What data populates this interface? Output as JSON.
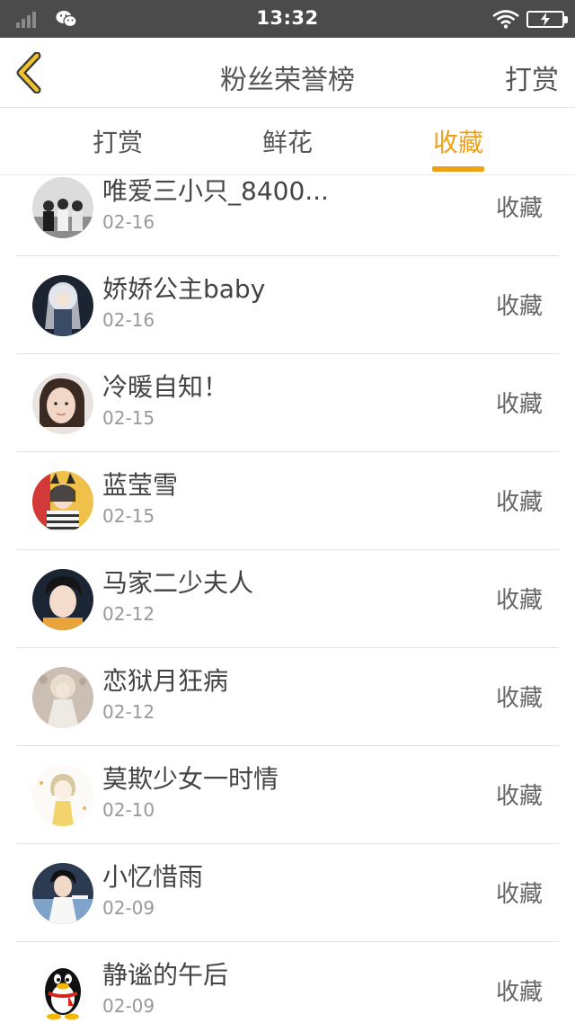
{
  "status_bar": {
    "time": "13:32"
  },
  "header": {
    "title": "粉丝荣誉榜",
    "reward_label": "打赏"
  },
  "tabs": [
    {
      "label": "打赏"
    },
    {
      "label": "鲜花"
    },
    {
      "label": "收藏"
    }
  ],
  "active_tab": "收藏",
  "colors": {
    "accent": "#eea117",
    "status_bar": "#4b4b4b"
  },
  "list": [
    {
      "name": "唯爱三小只_8400...",
      "date": "02-16",
      "action": "收藏",
      "avatar": "group-photo-avatar"
    },
    {
      "name": "娇娇公主baby",
      "date": "02-16",
      "action": "收藏",
      "avatar": "anime-girl-avatar"
    },
    {
      "name": "冷暖自知！",
      "date": "02-15",
      "action": "收藏",
      "avatar": "girl-photo-avatar"
    },
    {
      "name": "蓝莹雪",
      "date": "02-15",
      "action": "收藏",
      "avatar": "cat-ear-girl-avatar"
    },
    {
      "name": "马家二少夫人",
      "date": "02-12",
      "action": "收藏",
      "avatar": "boy-photo-avatar"
    },
    {
      "name": "恋狱月狂病",
      "date": "02-12",
      "action": "收藏",
      "avatar": "vintage-girl-avatar"
    },
    {
      "name": "莫欺少女一时情",
      "date": "02-10",
      "action": "收藏",
      "avatar": "cartoon-girl-avatar"
    },
    {
      "name": "小忆惜雨",
      "date": "02-09",
      "action": "收藏",
      "avatar": "boy-stage-avatar"
    },
    {
      "name": "静谧的午后",
      "date": "02-09",
      "action": "收藏",
      "avatar": "qq-penguin-avatar"
    }
  ]
}
